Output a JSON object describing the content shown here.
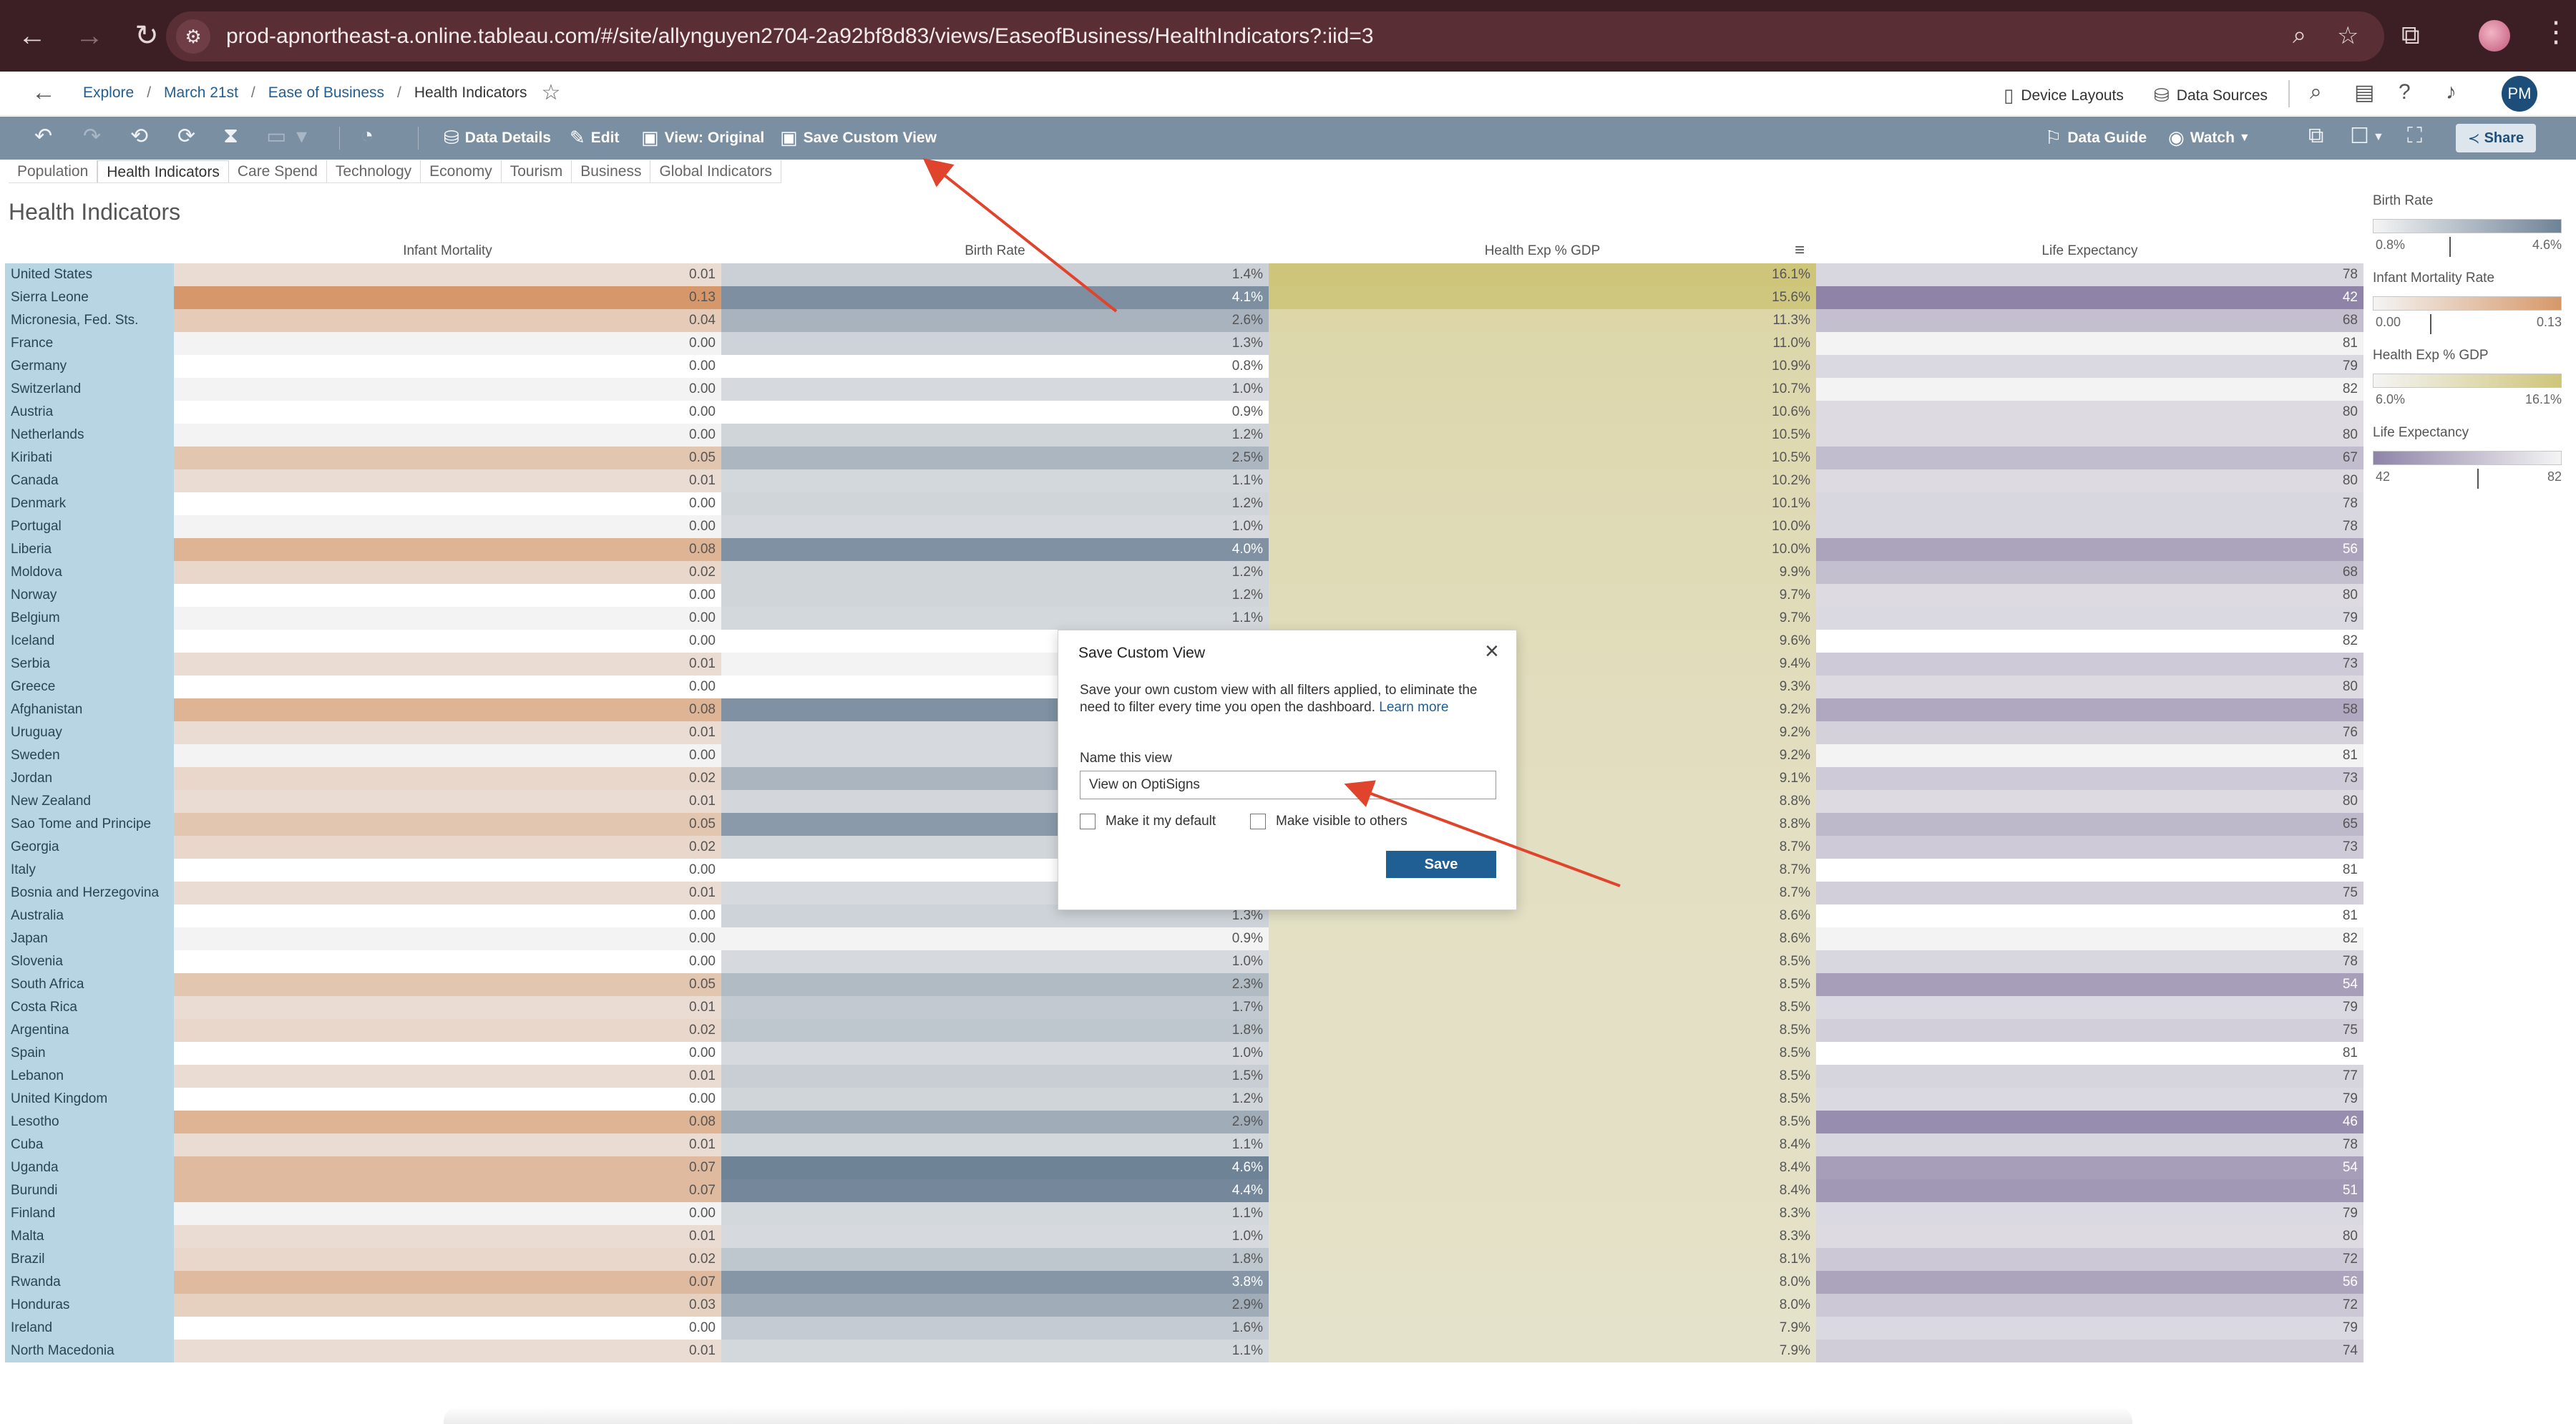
{
  "browser": {
    "url": "prod-apnortheast-a.online.tableau.com/#/site/allynguyen2704-2a92bf8d83/views/EaseofBusiness/HealthIndicators?:iid=3"
  },
  "nav": {
    "breadcrumbs": [
      {
        "label": "Explore",
        "link": true
      },
      {
        "label": "March 21st",
        "link": true
      },
      {
        "label": "Ease of Business",
        "link": true
      },
      {
        "label": "Health Indicators",
        "link": false
      }
    ],
    "device_layouts": "Device Layouts",
    "data_sources": "Data Sources",
    "avatar": "PM"
  },
  "toolbar": {
    "data_details": "Data Details",
    "edit": "Edit",
    "view_original": "View: Original",
    "save_custom_view": "Save Custom View",
    "data_guide": "Data Guide",
    "watch": "Watch",
    "share": "Share"
  },
  "tabs": [
    "Population",
    "Health Indicators",
    "Care Spend",
    "Technology",
    "Economy",
    "Tourism",
    "Business",
    "Global Indicators"
  ],
  "active_tab": 1,
  "sheet": {
    "title": "Health Indicators",
    "columns": [
      "Infant Mortality",
      "Birth Rate",
      "Health Exp % GDP",
      "Life Expectancy"
    ]
  },
  "colors": {
    "infant_mortality_max": "#d6986a",
    "birth_rate_max": "#6f8397",
    "health_exp_max": "#cfc57a",
    "life_expectancy_min": "#8f84a8",
    "country_bg": "#b7d5e2",
    "toolbar": "#7b8fa3",
    "accent": "#1f5f94",
    "annotation_arrow": "#e0442c"
  },
  "rows": [
    {
      "country": "United States",
      "infant": "0.01",
      "birth": "1.4%",
      "health": "16.1%",
      "life": "78"
    },
    {
      "country": "Sierra Leone",
      "infant": "0.13",
      "birth": "4.1%",
      "health": "15.6%",
      "life": "42"
    },
    {
      "country": "Micronesia, Fed. Sts.",
      "infant": "0.04",
      "birth": "2.6%",
      "health": "11.3%",
      "life": "68"
    },
    {
      "country": "France",
      "infant": "0.00",
      "birth": "1.3%",
      "health": "11.0%",
      "life": "81"
    },
    {
      "country": "Germany",
      "infant": "0.00",
      "birth": "0.8%",
      "health": "10.9%",
      "life": "79"
    },
    {
      "country": "Switzerland",
      "infant": "0.00",
      "birth": "1.0%",
      "health": "10.7%",
      "life": "82"
    },
    {
      "country": "Austria",
      "infant": "0.00",
      "birth": "0.9%",
      "health": "10.6%",
      "life": "80"
    },
    {
      "country": "Netherlands",
      "infant": "0.00",
      "birth": "1.2%",
      "health": "10.5%",
      "life": "80"
    },
    {
      "country": "Kiribati",
      "infant": "0.05",
      "birth": "2.5%",
      "health": "10.5%",
      "life": "67"
    },
    {
      "country": "Canada",
      "infant": "0.01",
      "birth": "1.1%",
      "health": "10.2%",
      "life": "80"
    },
    {
      "country": "Denmark",
      "infant": "0.00",
      "birth": "1.2%",
      "health": "10.1%",
      "life": "78"
    },
    {
      "country": "Portugal",
      "infant": "0.00",
      "birth": "1.0%",
      "health": "10.0%",
      "life": "78"
    },
    {
      "country": "Liberia",
      "infant": "0.08",
      "birth": "4.0%",
      "health": "10.0%",
      "life": "56"
    },
    {
      "country": "Moldova",
      "infant": "0.02",
      "birth": "1.2%",
      "health": "9.9%",
      "life": "68"
    },
    {
      "country": "Norway",
      "infant": "0.00",
      "birth": "1.2%",
      "health": "9.7%",
      "life": "80"
    },
    {
      "country": "Belgium",
      "infant": "0.00",
      "birth": "1.1%",
      "health": "9.7%",
      "life": "79"
    },
    {
      "country": "Iceland",
      "infant": "0.00",
      "birth": "",
      "health": "9.6%",
      "life": "82"
    },
    {
      "country": "Serbia",
      "infant": "0.01",
      "birth": "",
      "health": "9.4%",
      "life": "73"
    },
    {
      "country": "Greece",
      "infant": "0.00",
      "birth": "",
      "health": "9.3%",
      "life": "80"
    },
    {
      "country": "Afghanistan",
      "infant": "0.08",
      "birth": "",
      "health": "9.2%",
      "life": "58"
    },
    {
      "country": "Uruguay",
      "infant": "0.01",
      "birth": "",
      "health": "9.2%",
      "life": "76"
    },
    {
      "country": "Sweden",
      "infant": "0.00",
      "birth": "",
      "health": "9.2%",
      "life": "81"
    },
    {
      "country": "Jordan",
      "infant": "0.02",
      "birth": "",
      "health": "9.1%",
      "life": "73"
    },
    {
      "country": "New Zealand",
      "infant": "0.01",
      "birth": "",
      "health": "8.8%",
      "life": "80"
    },
    {
      "country": "Sao Tome and Principe",
      "infant": "0.05",
      "birth": "",
      "health": "8.8%",
      "life": "65"
    },
    {
      "country": "Georgia",
      "infant": "0.02",
      "birth": "",
      "health": "8.7%",
      "life": "73"
    },
    {
      "country": "Italy",
      "infant": "0.00",
      "birth": "",
      "health": "8.7%",
      "life": "81"
    },
    {
      "country": "Bosnia and Herzegovina",
      "infant": "0.01",
      "birth": "",
      "health": "8.7%",
      "life": "75"
    },
    {
      "country": "Australia",
      "infant": "0.00",
      "birth": "1.3%",
      "health": "8.6%",
      "life": "81"
    },
    {
      "country": "Japan",
      "infant": "0.00",
      "birth": "0.9%",
      "health": "8.6%",
      "life": "82"
    },
    {
      "country": "Slovenia",
      "infant": "0.00",
      "birth": "1.0%",
      "health": "8.5%",
      "life": "78"
    },
    {
      "country": "South Africa",
      "infant": "0.05",
      "birth": "2.3%",
      "health": "8.5%",
      "life": "54"
    },
    {
      "country": "Costa Rica",
      "infant": "0.01",
      "birth": "1.7%",
      "health": "8.5%",
      "life": "79"
    },
    {
      "country": "Argentina",
      "infant": "0.02",
      "birth": "1.8%",
      "health": "8.5%",
      "life": "75"
    },
    {
      "country": "Spain",
      "infant": "0.00",
      "birth": "1.0%",
      "health": "8.5%",
      "life": "81"
    },
    {
      "country": "Lebanon",
      "infant": "0.01",
      "birth": "1.5%",
      "health": "8.5%",
      "life": "77"
    },
    {
      "country": "United Kingdom",
      "infant": "0.00",
      "birth": "1.2%",
      "health": "8.5%",
      "life": "79"
    },
    {
      "country": "Lesotho",
      "infant": "0.08",
      "birth": "2.9%",
      "health": "8.5%",
      "life": "46"
    },
    {
      "country": "Cuba",
      "infant": "0.01",
      "birth": "1.1%",
      "health": "8.4%",
      "life": "78"
    },
    {
      "country": "Uganda",
      "infant": "0.07",
      "birth": "4.6%",
      "health": "8.4%",
      "life": "54"
    },
    {
      "country": "Burundi",
      "infant": "0.07",
      "birth": "4.4%",
      "health": "8.4%",
      "life": "51"
    },
    {
      "country": "Finland",
      "infant": "0.00",
      "birth": "1.1%",
      "health": "8.3%",
      "life": "79"
    },
    {
      "country": "Malta",
      "infant": "0.01",
      "birth": "1.0%",
      "health": "8.3%",
      "life": "80"
    },
    {
      "country": "Brazil",
      "infant": "0.02",
      "birth": "1.8%",
      "health": "8.1%",
      "life": "72"
    },
    {
      "country": "Rwanda",
      "infant": "0.07",
      "birth": "3.8%",
      "health": "8.0%",
      "life": "56"
    },
    {
      "country": "Honduras",
      "infant": "0.03",
      "birth": "2.9%",
      "health": "8.0%",
      "life": "72"
    },
    {
      "country": "Ireland",
      "infant": "0.00",
      "birth": "1.6%",
      "health": "7.9%",
      "life": "79"
    },
    {
      "country": "North Macedonia",
      "infant": "0.01",
      "birth": "1.1%",
      "health": "7.9%",
      "life": "74"
    }
  ],
  "hidden_birth_levels": {
    "Iceland": 0.02,
    "Serbia": 0.03,
    "Greece": 0.02,
    "Afghanistan": 0.85,
    "Uruguay": 0.05,
    "Sweden": 0.05,
    "Jordan": 0.45,
    "New Zealand": 0.08,
    "Sao Tome and Principe": 0.75,
    "Georgia": 0.1,
    "Italy": 0.03,
    "Bosnia and Herzegovina": 0.05
  },
  "legends": [
    {
      "title": "Birth Rate",
      "min": "0.8%",
      "max": "4.6%"
    },
    {
      "title": "Infant Mortality Rate",
      "min": "0.00",
      "max": "0.13"
    },
    {
      "title": "Health Exp % GDP",
      "min": "6.0%",
      "max": "16.1%"
    },
    {
      "title": "Life Expectancy",
      "min": "42",
      "max": "82"
    }
  ],
  "dialog": {
    "title": "Save Custom View",
    "description": "Save your own custom view with all filters applied, to eliminate the need to filter every time you open the dashboard.",
    "learn_more": "Learn more",
    "name_label": "Name this view",
    "name_value": "View on OptiSigns",
    "default_label": "Make it my default",
    "visible_label": "Make visible to others",
    "save_label": "Save"
  }
}
